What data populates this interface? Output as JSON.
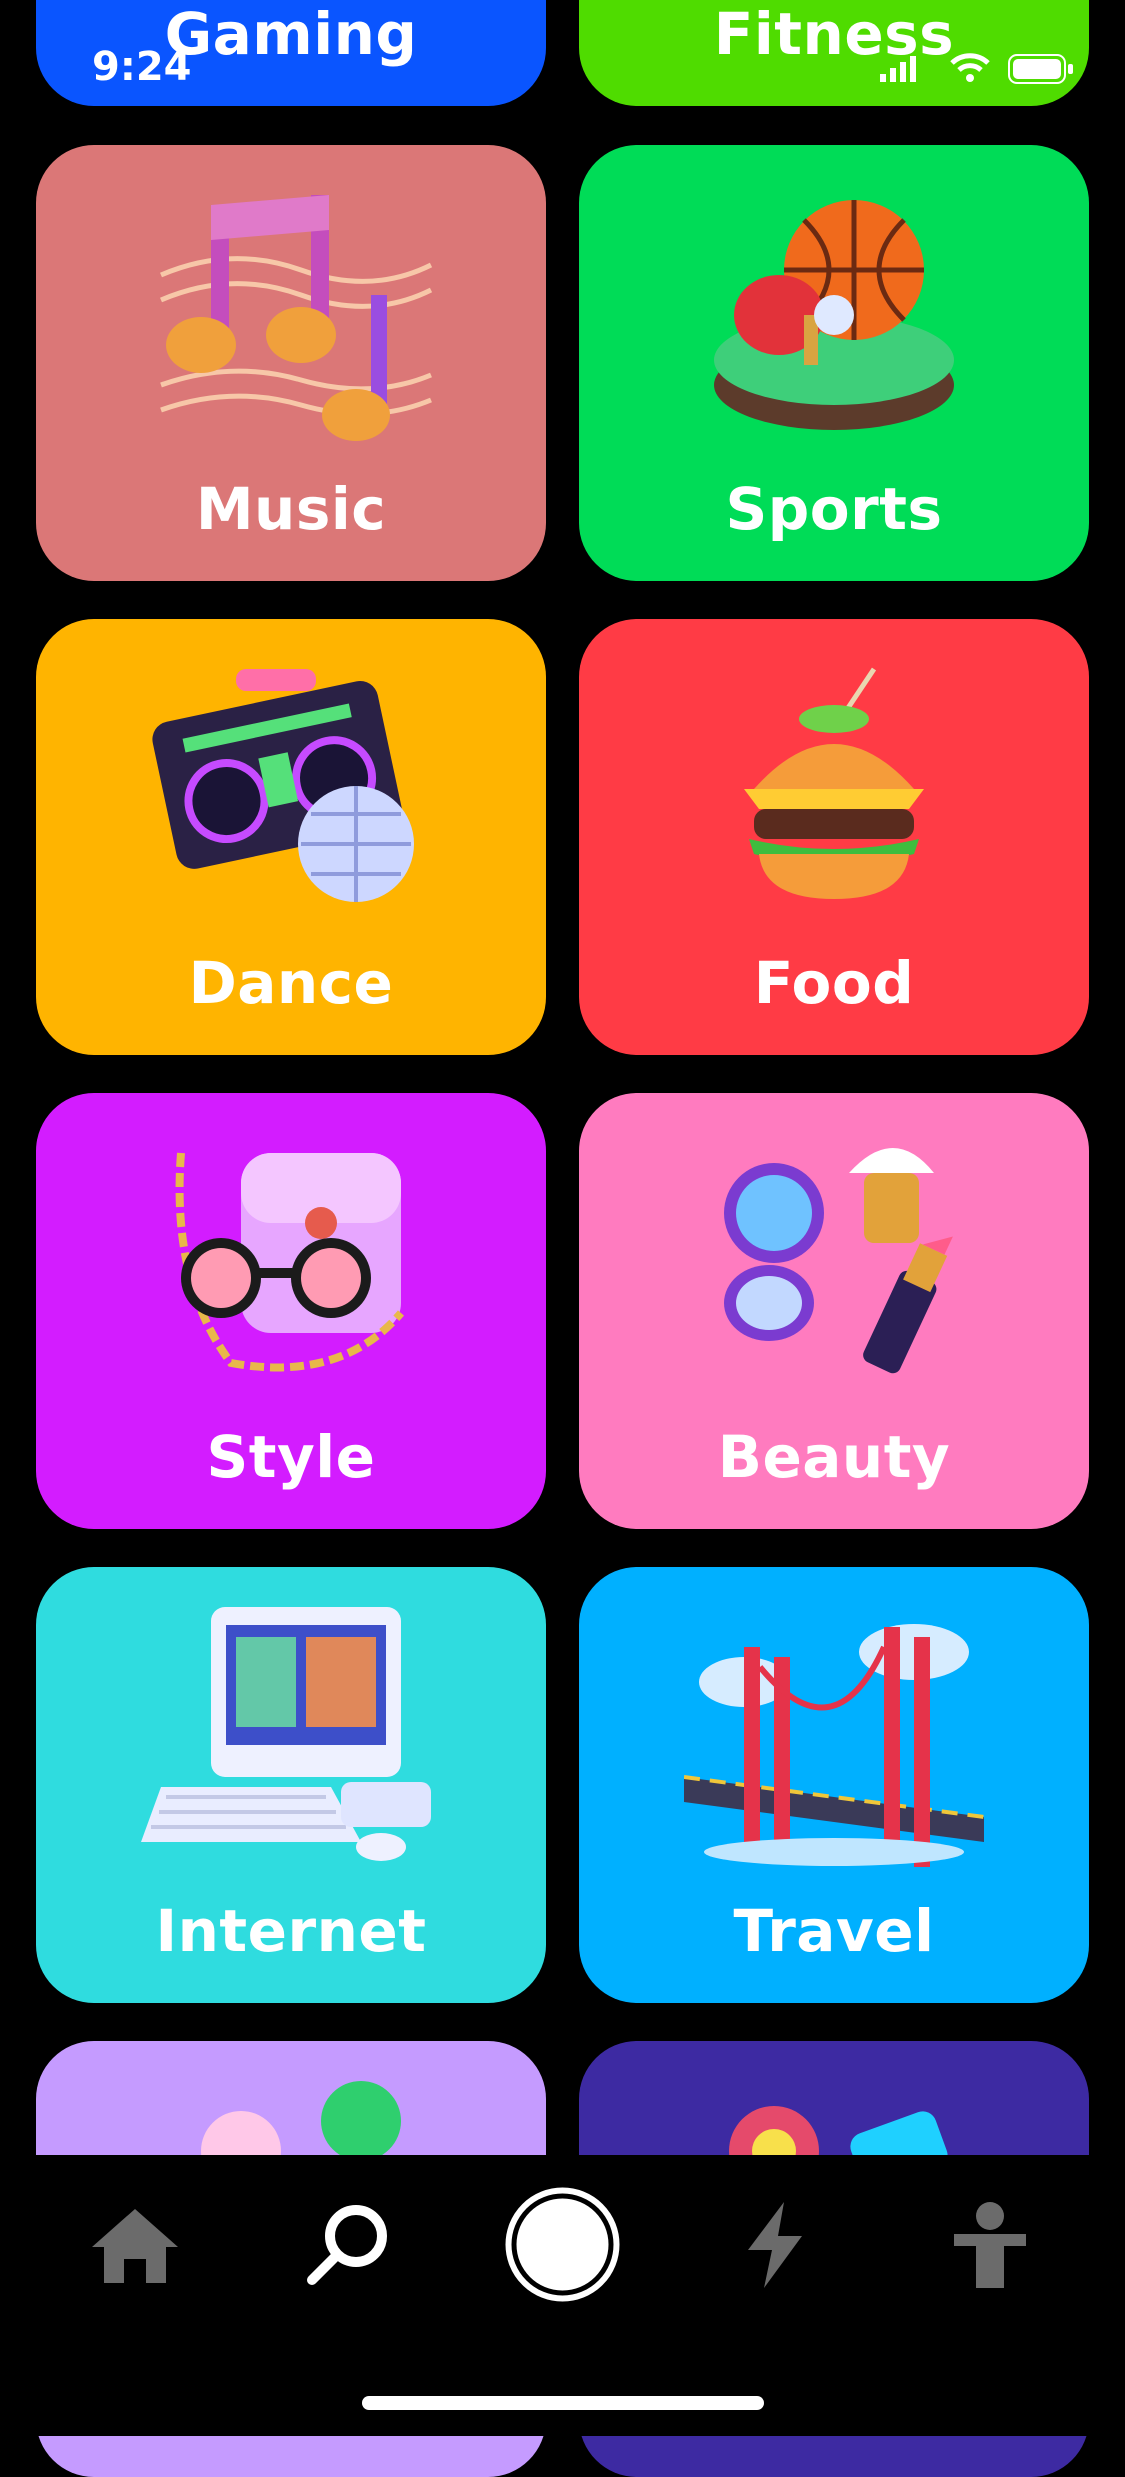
{
  "status_bar": {
    "time": "9:24"
  },
  "categories": [
    {
      "label": "Gaming",
      "color": "#0a55ff",
      "icon": "gaming-illustration"
    },
    {
      "label": "Fitness",
      "color": "#4fdc00",
      "icon": "fitness-illustration"
    },
    {
      "label": "Music",
      "color": "#db7777",
      "icon": "music-notes-illustration"
    },
    {
      "label": "Sports",
      "color": "#00dc57",
      "icon": "sports-balls-illustration"
    },
    {
      "label": "Dance",
      "color": "#ffb400",
      "icon": "boombox-discoball-illustration"
    },
    {
      "label": "Food",
      "color": "#ff3b45",
      "icon": "burger-illustration"
    },
    {
      "label": "Style",
      "color": "#d31cff",
      "icon": "glasses-bag-illustration"
    },
    {
      "label": "Beauty",
      "color": "#ff7bbf",
      "icon": "makeup-illustration"
    },
    {
      "label": "Internet",
      "color": "#2fdcdf",
      "icon": "retro-computer-illustration"
    },
    {
      "label": "Travel",
      "color": "#00b0ff",
      "icon": "bridge-illustration"
    },
    {
      "label": "",
      "color": "#c59bff",
      "icon": "nature-illustration"
    },
    {
      "label": "",
      "color": "#3d2aa2",
      "icon": "misc-illustration"
    }
  ],
  "tab_bar": {
    "items": [
      {
        "name": "home",
        "icon": "home-icon"
      },
      {
        "name": "search",
        "icon": "search-icon"
      },
      {
        "name": "camera",
        "icon": "record-button-icon"
      },
      {
        "name": "activity",
        "icon": "lightning-icon"
      },
      {
        "name": "profile",
        "icon": "person-icon"
      }
    ]
  }
}
